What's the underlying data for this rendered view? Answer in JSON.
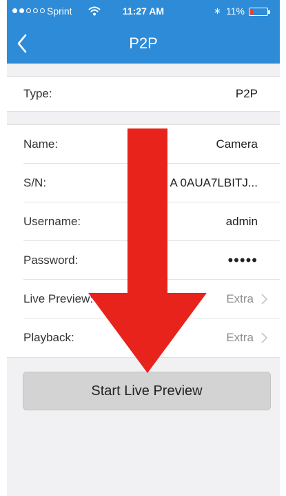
{
  "status_bar": {
    "carrier": "Sprint",
    "time": "11:27 AM",
    "battery": "11%",
    "bluetooth_glyph": "∗",
    "icons": [
      "wifi-icon",
      "bluetooth-icon",
      "battery-icon"
    ]
  },
  "nav": {
    "title": "P2P",
    "back_icon": "chevron-left-icon"
  },
  "device": {
    "type_label": "Type:",
    "type_value": "P2P",
    "name_label": "Name:",
    "name_value": "Camera",
    "sn_label": "S/N:",
    "sn_value": "A     0AUA7LBITJ...",
    "username_label": "Username:",
    "username_value": "admin",
    "password_label": "Password:",
    "password_value": "•••••",
    "live_preview_label": "Live Preview:",
    "live_preview_value": "Extra",
    "playback_label": "Playback:",
    "playback_value": "Extra"
  },
  "actions": {
    "start_live_preview": "Start Live Preview"
  },
  "colors": {
    "nav_bar": "#2d8bd8",
    "page_bg": "#f1f1f4",
    "button_bg": "#d3d3d3",
    "overlay_arrow": "#e8231c"
  }
}
